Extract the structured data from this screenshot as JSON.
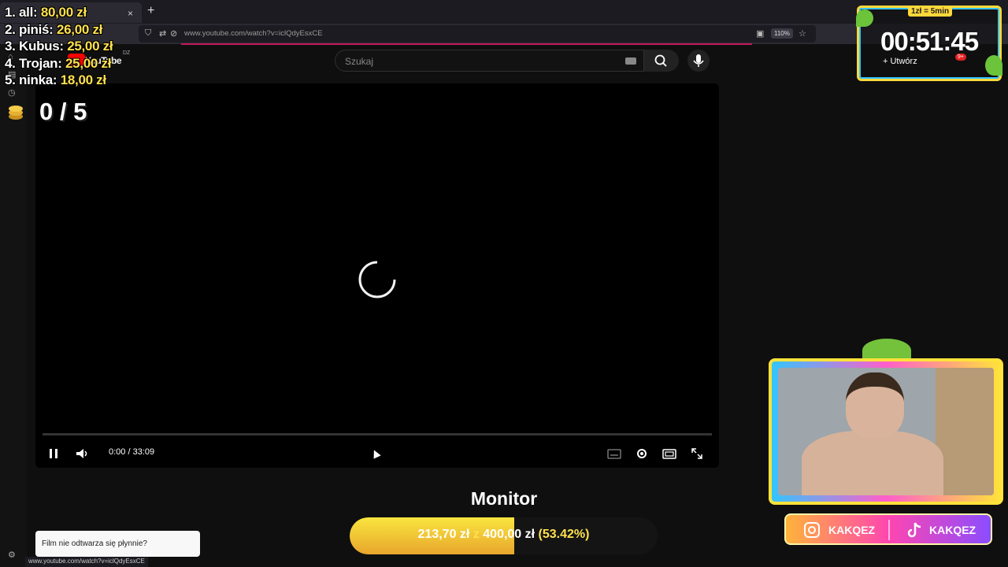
{
  "browser": {
    "url": "www.youtube.com/watch?v=iclQdyEsxCE",
    "zoom": "110%",
    "tab_close": "×",
    "new_tab": "+"
  },
  "youtube": {
    "logo_text": "YouTube",
    "country_code": "DZ",
    "search_placeholder": "Szukaj",
    "create_label": "Utwórz",
    "notifications_badge": "9+"
  },
  "player": {
    "time": "0:00 / 33:09",
    "progress": 0.0
  },
  "overlay": {
    "leaderboard": [
      {
        "rank": "1.",
        "name": "all:",
        "amount": "80,00 zł"
      },
      {
        "rank": "2.",
        "name": "piniś:",
        "amount": "26,00 zł"
      },
      {
        "rank": "3.",
        "name": "Kubus:",
        "amount": "25,00 zł"
      },
      {
        "rank": "4.",
        "name": "Trojan:",
        "amount": "25,00 zł"
      },
      {
        "rank": "5.",
        "name": "ninka:",
        "amount": "18,00 zł"
      }
    ],
    "counter": "0 / 5",
    "timer_rate": "1zł = 5min",
    "timer": "00:51:45"
  },
  "goal": {
    "title": "Monitor",
    "current": "213,70 zł",
    "separator": "z",
    "target": "400,00 zł",
    "percent_label": "(53.42%)",
    "fraction": 0.5342
  },
  "socials": {
    "instagram": "KAKQEZ",
    "tiktok": "KAKQEZ"
  },
  "toast": {
    "text": "Film nie odtwarza się płynnie?"
  },
  "status_bar": {
    "link": "www.youtube.com/watch?v=iclQdyEsxCE"
  },
  "colors": {
    "accent_yellow": "#ffe14d",
    "youtube_red": "#ff0000",
    "url_underline": "#c2185b"
  }
}
